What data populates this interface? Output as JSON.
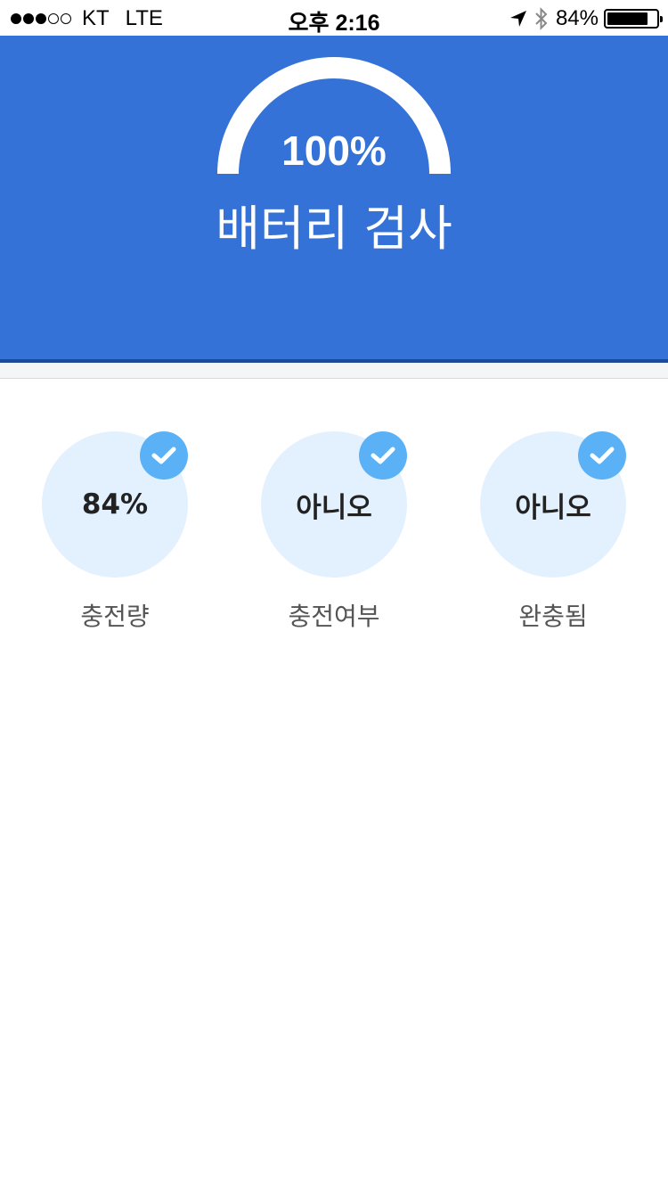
{
  "status_bar": {
    "carrier": "KT",
    "network": "LTE",
    "time": "오후 2:16",
    "battery_percent": "84%",
    "signal_bars_filled": 3,
    "signal_bars_total": 5
  },
  "header": {
    "gauge_value": "100%",
    "gauge_fraction": 1.0,
    "title": "배터리 검사",
    "background_color": "#3472d7"
  },
  "stats": [
    {
      "value": "84%",
      "label": "충전량",
      "checked": true
    },
    {
      "value": "아니오",
      "label": "충전여부",
      "checked": true
    },
    {
      "value": "아니오",
      "label": "완충됨",
      "checked": true
    }
  ],
  "colors": {
    "stat_circle": "#e3f1fe",
    "check_badge": "#5ab1f6"
  },
  "icons": {
    "location": "location-arrow-icon",
    "bluetooth": "bluetooth-icon",
    "battery": "battery-icon",
    "check": "check-icon"
  }
}
